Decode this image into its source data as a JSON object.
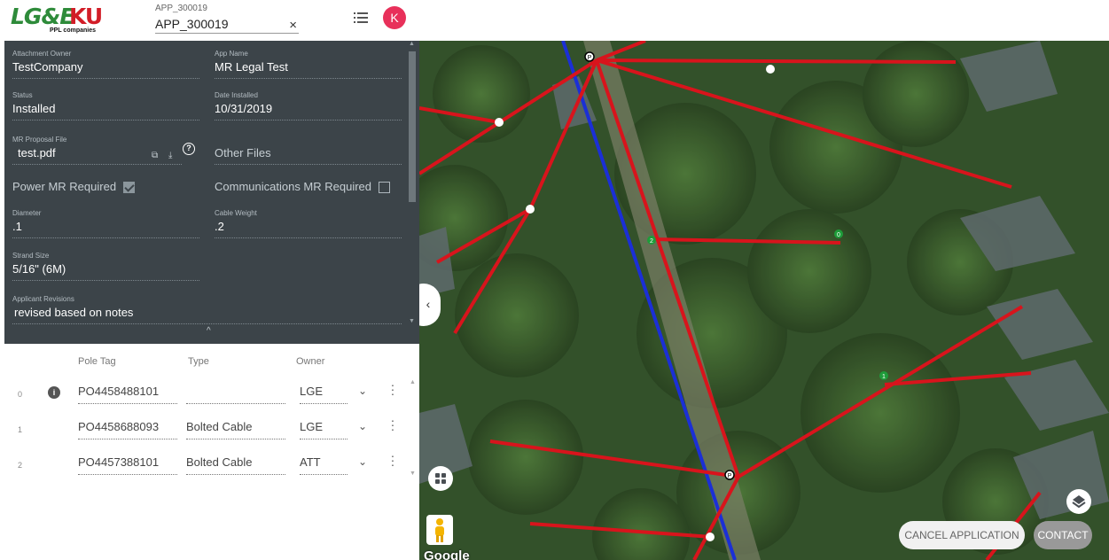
{
  "header": {
    "logo_lge": "LG&E",
    "logo_ku": "KU",
    "logo_tagline": "PPL companies",
    "app_select_label": "APP_300019",
    "app_select_value": "APP_300019",
    "clear_symbol": "×",
    "avatar_initial": "K"
  },
  "details": {
    "attachment_owner": {
      "label": "Attachment Owner",
      "value": "TestCompany"
    },
    "app_name": {
      "label": "App Name",
      "value": "MR Legal Test"
    },
    "status": {
      "label": "Status",
      "value": "Installed"
    },
    "date_installed": {
      "label": "Date Installed",
      "value": "10/31/2019"
    },
    "mr_proposal_file": {
      "label": "MR Proposal File",
      "value": "test.pdf"
    },
    "other_files": {
      "value": "Other Files"
    },
    "power_mr_required": {
      "label": "Power MR Required",
      "checked": true
    },
    "communications_mr_required": {
      "label": "Communications MR Required",
      "checked": false
    },
    "diameter": {
      "label": "Diameter",
      "value": ".1"
    },
    "cable_weight": {
      "label": "Cable Weight",
      "value": ".2"
    },
    "strand_size": {
      "label": "Strand Size",
      "value": "5/16\" (6M)"
    },
    "applicant_revisions": {
      "label": "Applicant Revisions",
      "value": "revised based on notes"
    },
    "collapse_symbol": "^"
  },
  "table": {
    "columns": [
      "Pole Tag",
      "Type",
      "Owner"
    ],
    "rows": [
      {
        "index": "0",
        "pole_tag": "PO4458488101",
        "type": "",
        "owner": "LGE"
      },
      {
        "index": "1",
        "pole_tag": "PO4458688093",
        "type": "Bolted Cable",
        "owner": "LGE"
      },
      {
        "index": "2",
        "pole_tag": "PO4457388101",
        "type": "Bolted Cable",
        "owner": "ATT"
      }
    ]
  },
  "map": {
    "attribution": "Google",
    "cancel_button": "CANCEL APPLICATION",
    "contact_button": "CONTACT",
    "pole_labels": [
      "P",
      "2",
      "0",
      "1",
      "P"
    ],
    "colors": {
      "power_line": "#d8141c",
      "comm_line": "#1b2fd6",
      "pole_green": "#1e9c3a"
    }
  }
}
